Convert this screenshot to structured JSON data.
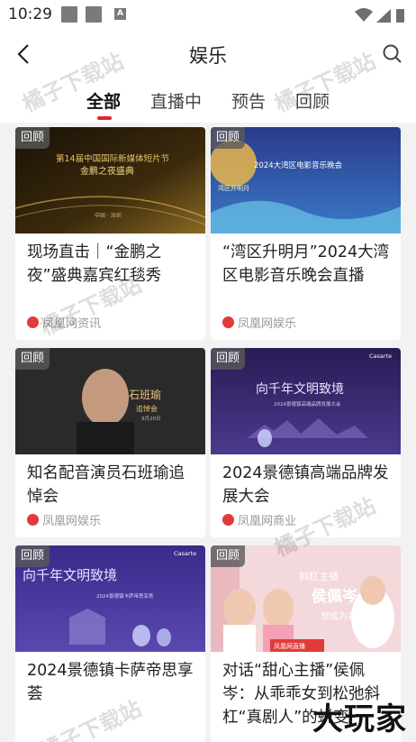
{
  "status_bar": {
    "time": "10:29",
    "icon_a": "A"
  },
  "header": {
    "title": "娱乐"
  },
  "tabs": [
    {
      "label": "全部",
      "active": true
    },
    {
      "label": "直播中",
      "active": false
    },
    {
      "label": "预告",
      "active": false
    },
    {
      "label": "回顾",
      "active": false
    }
  ],
  "cards": [
    {
      "badge": "回顾",
      "title": "现场直击｜“金鹏之夜”盛典嘉宾红毯秀",
      "source": "凤凰网资讯",
      "thumb_text": [
        "第14届中国国际新媒体短片节",
        "金鹏之夜盛典",
        "中国 · 深圳"
      ]
    },
    {
      "badge": "回顾",
      "title": "“湾区升明月”2024大湾区电影音乐晚会直播",
      "source": "凤凰网娱乐",
      "thumb_text": [
        "2024大湾区电影音乐晚会",
        "湾区升明月"
      ]
    },
    {
      "badge": "回顾",
      "title": "知名配音演员石班瑜追悼会",
      "source": "凤凰网娱乐",
      "thumb_text": [
        "石班瑜",
        "追悼会",
        "9月20日"
      ]
    },
    {
      "badge": "回顾",
      "title": "2024景德镇高端品牌发展大会",
      "source": "凤凰网商业",
      "thumb_text": [
        "向千年文明致境",
        "2024景德镇高端品牌发展大会",
        "Casarte"
      ]
    },
    {
      "badge": "回顾",
      "title": "2024景德镇卡萨帝思享荟",
      "source": "",
      "thumb_text": [
        "向千年文明致境",
        "2024景德镇卡萨帝思享荟",
        "Casarte"
      ]
    },
    {
      "badge": "回顾",
      "title": "对话“甜心主播”侯佩岑：从乖乖女到松弛斜杠“真剧人”的蜕变",
      "source": "",
      "thumb_text": [
        "斜杠主播",
        "侯佩岑",
        "想成为喜剧",
        "凤凰网直播"
      ]
    }
  ],
  "watermark_text": "橘子下载站",
  "corner_logo_text": "大玩家",
  "colors": {
    "accent": "#e5222a",
    "badge_bg": "#5a5a5a"
  }
}
